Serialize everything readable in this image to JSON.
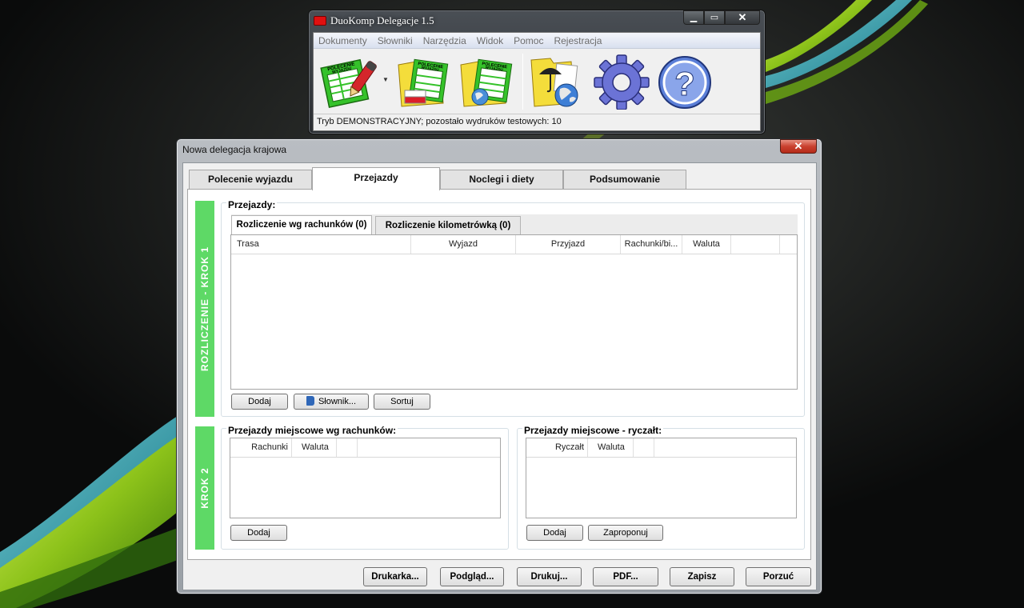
{
  "main_window": {
    "title": "DuoKomp Delegacje 1.5",
    "menu": [
      "Dokumenty",
      "Słowniki",
      "Narzędzia",
      "Widok",
      "Pomoc",
      "Rejestracja"
    ],
    "toolbar_icons": {
      "t1": {
        "text1": "POLECENIE",
        "text2": "WYJAZDU"
      },
      "t2": {
        "text1": "POLECENIE",
        "text2": "WYJAZDU"
      },
      "t3": {
        "text1": "POLECENIE",
        "text2": "WYJAZDU"
      }
    },
    "status": "Tryb DEMONSTRACYJNY; pozostało wydruków testowych: 10",
    "caption": {
      "minimize": "▁",
      "maximize": "▭",
      "close": "✕"
    }
  },
  "dialog": {
    "title": "Nowa delegacja krajowa",
    "close": "✕",
    "tabs": [
      "Polecenie wyjazdu",
      "Przejazdy",
      "Noclegi i diety",
      "Podsumowanie"
    ],
    "active_tab": "Przejazdy",
    "step1": {
      "label": "ROZLICZENIE - KROK 1",
      "group_title": "Przejazdy:",
      "subtabs": [
        "Rozliczenie wg rachunków (0)",
        "Rozliczenie kilometrówką (0)"
      ],
      "columns": [
        "Trasa",
        "Wyjazd",
        "Przyjazd",
        "Rachunki/bi...",
        "Waluta"
      ],
      "buttons": {
        "add": "Dodaj",
        "dictionary": "Słownik...",
        "sort": "Sortuj"
      }
    },
    "step2": {
      "label": "KROK 2",
      "left": {
        "title": "Przejazdy miejscowe wg rachunków:",
        "columns": [
          "Rachunki",
          "Waluta"
        ],
        "buttons": {
          "add": "Dodaj"
        }
      },
      "right": {
        "title": "Przejazdy miejscowe - ryczałt:",
        "columns": [
          "Ryczałt",
          "Waluta"
        ],
        "buttons": {
          "add": "Dodaj",
          "propose": "Zaproponuj"
        }
      }
    },
    "footer_buttons": {
      "printer": "Drukarka...",
      "preview": "Podgląd...",
      "print": "Drukuj...",
      "pdf": "PDF...",
      "save": "Zapisz",
      "discard": "Porzuć"
    }
  },
  "colors": {
    "step_green": "#5ed966",
    "desktop_bg": "#0b0c0c",
    "lime_swoosh": "#a6d61a",
    "teal_swoosh": "#1aa7b8"
  }
}
